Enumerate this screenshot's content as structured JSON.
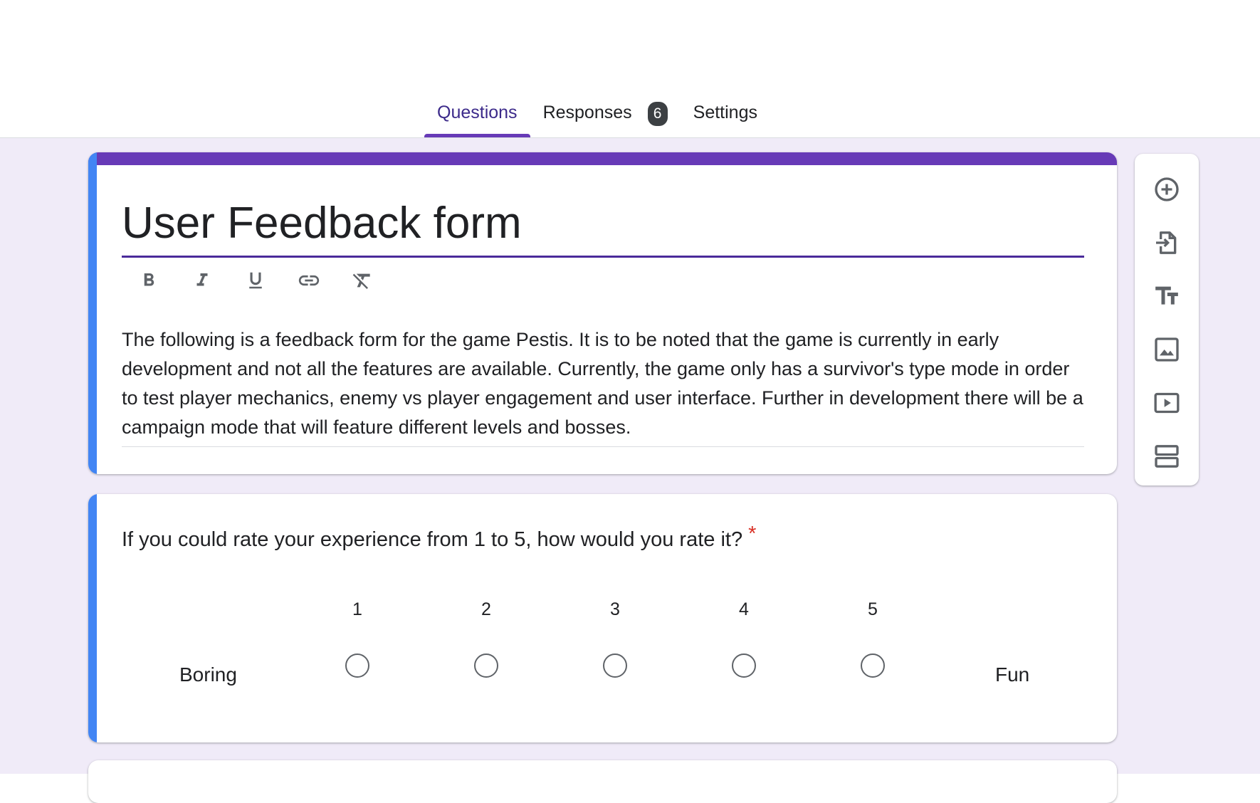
{
  "tabs": [
    {
      "label": "Questions",
      "active": true
    },
    {
      "label": "Responses",
      "badge": "6"
    },
    {
      "label": "Settings"
    }
  ],
  "form": {
    "title": "User Feedback form",
    "description": "The following is a feedback form for the game Pestis.  It is to be noted that the game is currently in early development and not all the features are available. Currently, the game only has a survivor's type mode in order to test player mechanics, enemy vs player engagement and user interface. Further in development there will be a campaign mode that will feature different levels and bosses.",
    "format_toolbar": [
      "bold-icon",
      "italic-icon",
      "underline-icon",
      "link-icon",
      "clear-formatting-icon"
    ]
  },
  "question": {
    "text": "If you could rate your experience from 1 to 5, how would you rate it?",
    "required_mark": "*",
    "scale": [
      "1",
      "2",
      "3",
      "4",
      "5"
    ],
    "low_label": "Boring",
    "high_label": "Fun"
  },
  "side_toolbar": [
    "add-question-icon",
    "import-questions-icon",
    "add-title-icon",
    "add-image-icon",
    "add-video-icon",
    "add-section-icon"
  ],
  "colors": {
    "theme": "#673ab7",
    "active_accent": "#4285f4",
    "background": "#f0ebf8",
    "required": "#d93025"
  }
}
